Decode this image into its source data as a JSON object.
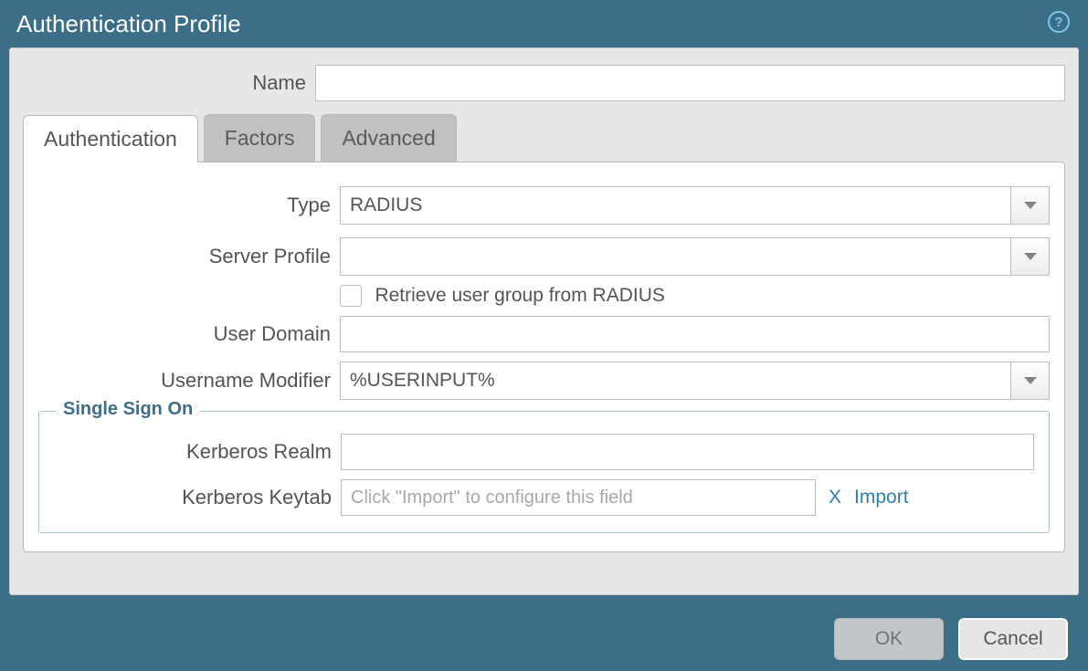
{
  "dialog": {
    "title": "Authentication Profile",
    "help_icon": "?"
  },
  "name": {
    "label": "Name",
    "value": ""
  },
  "tabs": {
    "authentication": "Authentication",
    "factors": "Factors",
    "advanced": "Advanced"
  },
  "auth": {
    "type": {
      "label": "Type",
      "value": "RADIUS"
    },
    "server_profile": {
      "label": "Server Profile",
      "value": ""
    },
    "retrieve_group": {
      "label": "Retrieve user group from RADIUS",
      "checked": false
    },
    "user_domain": {
      "label": "User Domain",
      "value": ""
    },
    "username_modifier": {
      "label": "Username Modifier",
      "value": "%USERINPUT%"
    }
  },
  "sso": {
    "legend": "Single Sign On",
    "kerberos_realm": {
      "label": "Kerberos Realm",
      "value": ""
    },
    "kerberos_keytab": {
      "label": "Kerberos Keytab",
      "placeholder": "Click \"Import\" to configure this field",
      "clear": "X",
      "import": "Import"
    }
  },
  "buttons": {
    "ok": "OK",
    "cancel": "Cancel"
  }
}
